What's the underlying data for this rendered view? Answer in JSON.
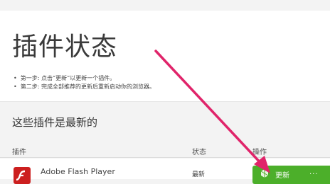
{
  "page": {
    "title": "插件状态",
    "steps": [
      "第一步: 点击“更新”以更新一个插件。",
      "第二步: 完成全部推荐的更新后重新启动你的浏览器。"
    ]
  },
  "section": {
    "title": "这些插件是最新的"
  },
  "table": {
    "headers": {
      "plugin": "插件",
      "status": "状态",
      "action": "操作"
    },
    "rows": [
      {
        "name": "Adobe Flash Player",
        "status": "最新",
        "action": "更新",
        "extra": "..."
      }
    ]
  },
  "colors": {
    "button": "#4caf2a",
    "arrow": "#e0246a",
    "flash_icon": "#cc1f1f"
  },
  "icons": {
    "plugin": "flash-player-icon",
    "button": "puzzle-icon"
  }
}
